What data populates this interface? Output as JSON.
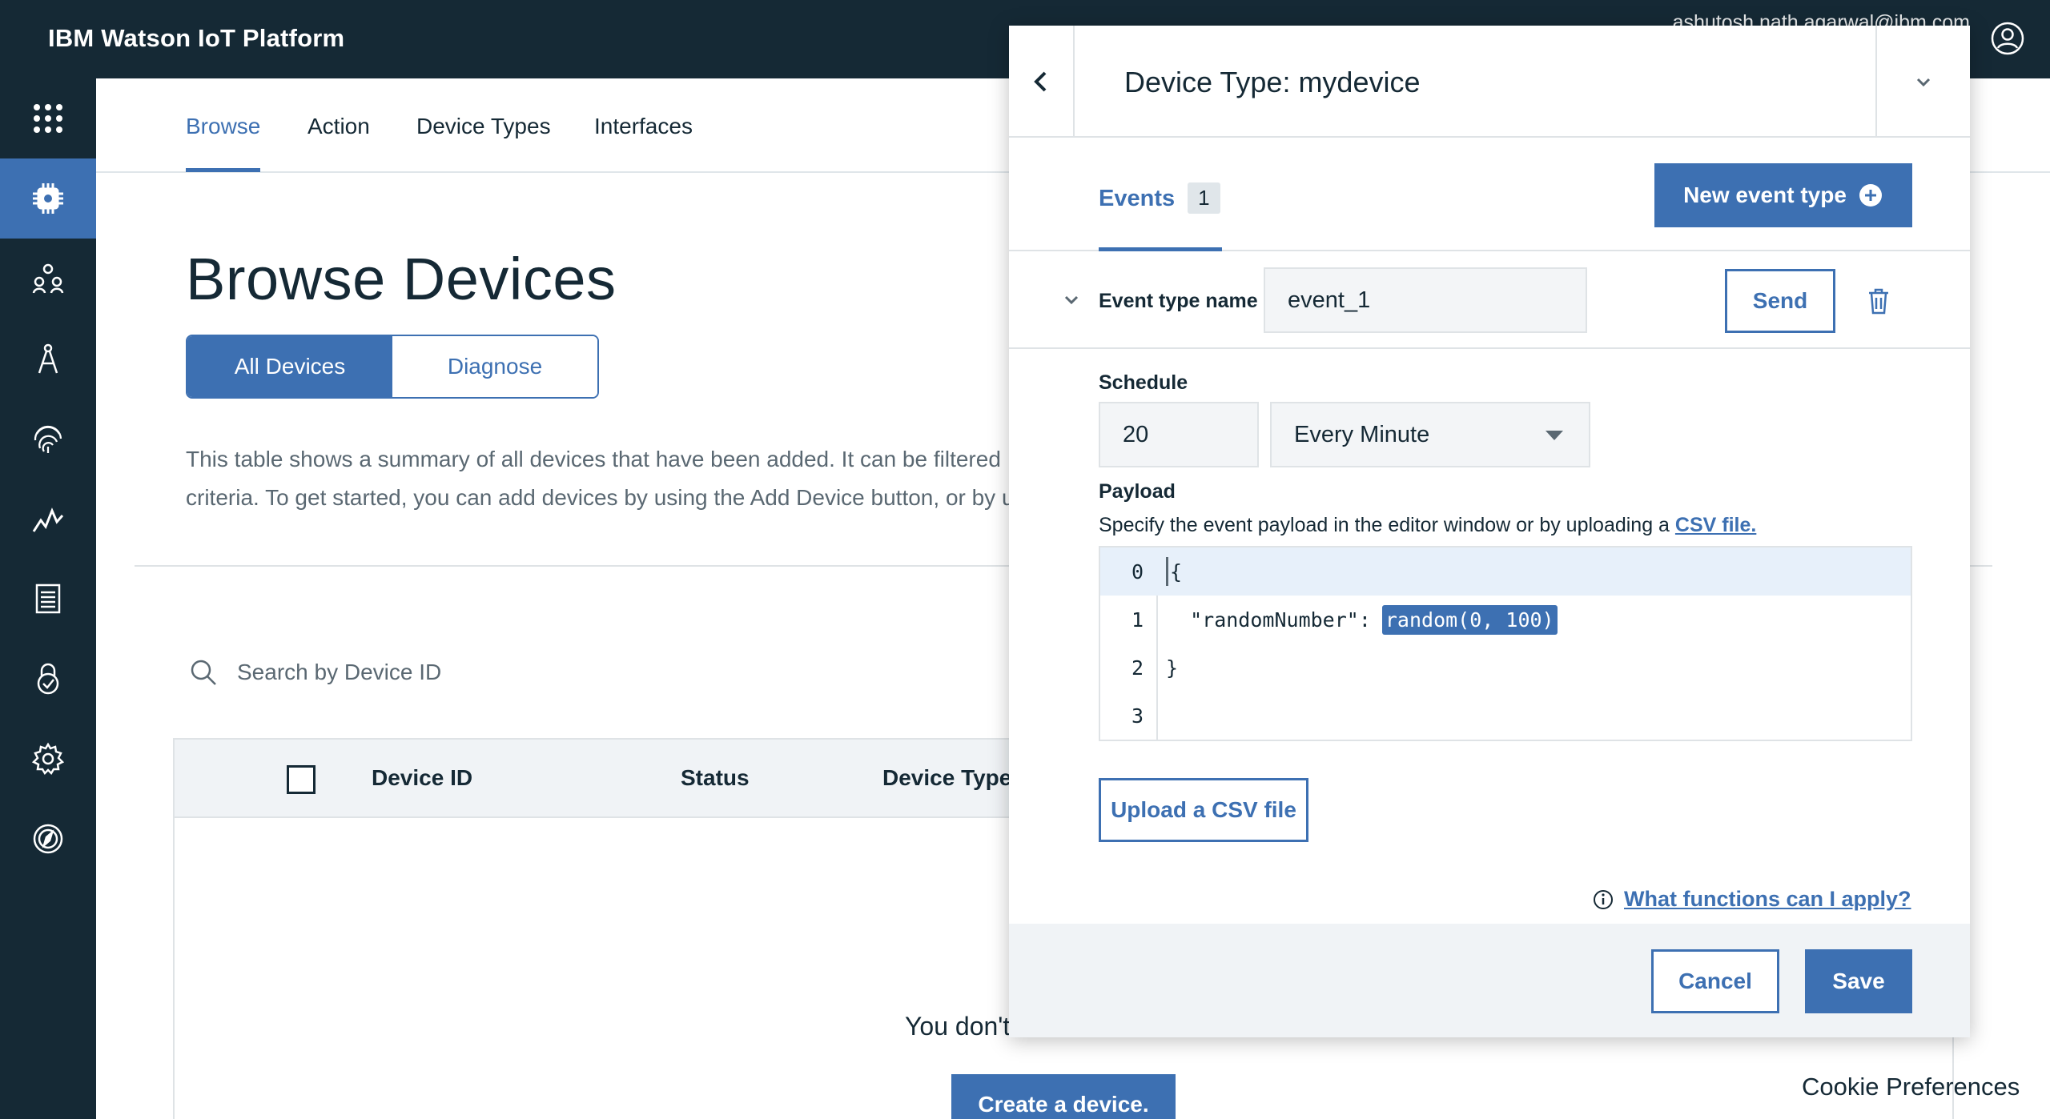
{
  "header": {
    "brand": "IBM Watson IoT Platform",
    "user_email": "ashutosh.nath.agarwal@ibm.com"
  },
  "rail": {
    "items": [
      "apps-icon",
      "devices-icon",
      "members-icon",
      "apps-compass-icon",
      "security-fingerprint-icon",
      "usage-chart-icon",
      "logs-icon",
      "risk-lock-icon",
      "settings-icon",
      "explore-icon"
    ],
    "active": "devices-icon"
  },
  "subnav": {
    "tabs": [
      {
        "label": "Browse"
      },
      {
        "label": "Action"
      },
      {
        "label": "Device Types"
      },
      {
        "label": "Interfaces"
      }
    ],
    "active": "Browse"
  },
  "page": {
    "title": "Browse Devices",
    "toggle": {
      "all_devices": "All Devices",
      "diagnose": "Diagnose",
      "active": "All Devices"
    },
    "description_line1": "This table shows a summary of all devices that have been added. It can be filtered",
    "description_line2": "criteria. To get started, you can add devices by using the Add Device button, or by u",
    "search": {
      "placeholder": "Search by Device ID",
      "value": ""
    },
    "table": {
      "columns": [
        "Device ID",
        "Status",
        "Device Type"
      ]
    },
    "empty_text": "You don't",
    "create_button": "Create a device."
  },
  "cookie_preferences": "Cookie Preferences",
  "panel": {
    "title": "Device Type: mydevice",
    "tabs": [
      {
        "label": "Events",
        "count": "1"
      }
    ],
    "new_event_button": "New event type",
    "event": {
      "name_label": "Event type name",
      "name_value": "event_1",
      "send_button": "Send"
    },
    "schedule": {
      "label": "Schedule",
      "value": "20",
      "frequency": "Every Minute"
    },
    "payload": {
      "label": "Payload",
      "description": "Specify the event payload in the editor window or by uploading a",
      "csv_link": "CSV file.",
      "lines": [
        {
          "num": "0",
          "text": "{"
        },
        {
          "num": "1",
          "key": "  \"randomNumber\":",
          "value": "random(0, 100)"
        },
        {
          "num": "2",
          "text": "}"
        },
        {
          "num": "3",
          "text": ""
        }
      ]
    },
    "upload_button": "Upload a CSV file",
    "help_link": "What functions can I apply?",
    "cancel_button": "Cancel",
    "save_button": "Save"
  },
  "colors": {
    "header_bg": "#152935",
    "accent": "#3d70b2",
    "footer_bg": "#f0f3f6"
  }
}
